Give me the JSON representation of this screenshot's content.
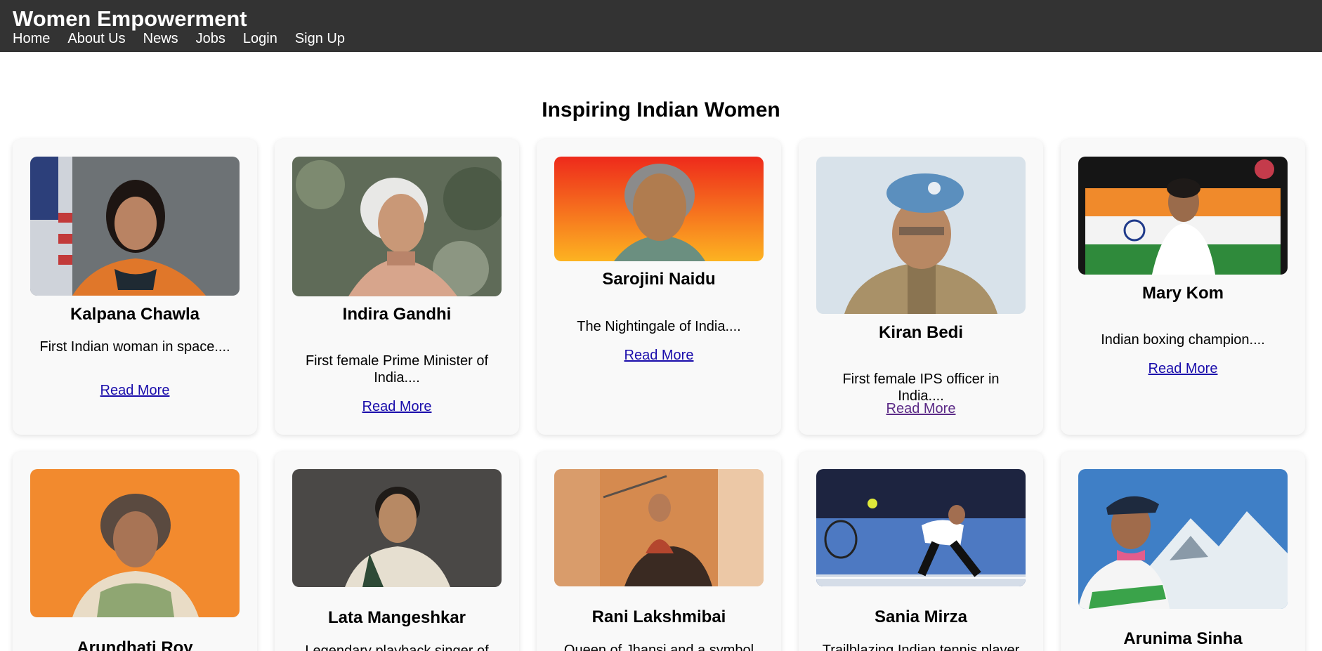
{
  "header": {
    "title": "Women Empowerment",
    "nav": [
      "Home",
      "About Us",
      "News",
      "Jobs",
      "Login",
      "Sign Up"
    ]
  },
  "main": {
    "title": "Inspiring Indian Women",
    "read_more": "Read More",
    "women": [
      {
        "name": "Kalpana Chawla",
        "desc": "First Indian woman in space...."
      },
      {
        "name": "Indira Gandhi",
        "desc": "First female Prime Minister of India...."
      },
      {
        "name": "Sarojini Naidu",
        "desc": "The Nightingale of India...."
      },
      {
        "name": "Kiran Bedi",
        "desc": "First female IPS officer in India...."
      },
      {
        "name": "Mary Kom",
        "desc": "Indian boxing champion...."
      },
      {
        "name": "Arundhati Roy",
        "desc": ""
      },
      {
        "name": "Lata Mangeshkar",
        "desc": "Legendary playback singer of"
      },
      {
        "name": "Rani Lakshmibai",
        "desc": "Queen of Jhansi and a symbol of"
      },
      {
        "name": "Sania Mirza",
        "desc": "Trailblazing Indian tennis player"
      },
      {
        "name": "Arunima Sinha",
        "desc": ""
      }
    ]
  },
  "colors": {
    "header_bg": "#333333",
    "link": "#1a0dab",
    "visited_link": "#5b2a86",
    "card_bg": "#f9f9f9"
  }
}
